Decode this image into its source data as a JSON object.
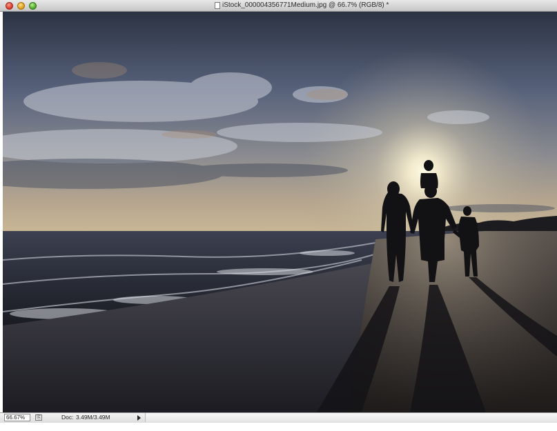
{
  "window": {
    "title": "iStock_000004356771Medium.jpg @ 66.7% (RGB/8) *",
    "controls": [
      "close",
      "minimize",
      "zoom"
    ]
  },
  "canvas": {
    "description_icon": "photo-canvas"
  },
  "statusbar": {
    "zoom": "66.67%",
    "doc_label": "Doc:",
    "doc_value": "3.49M/3.49M",
    "export_icon": "export-icon"
  }
}
